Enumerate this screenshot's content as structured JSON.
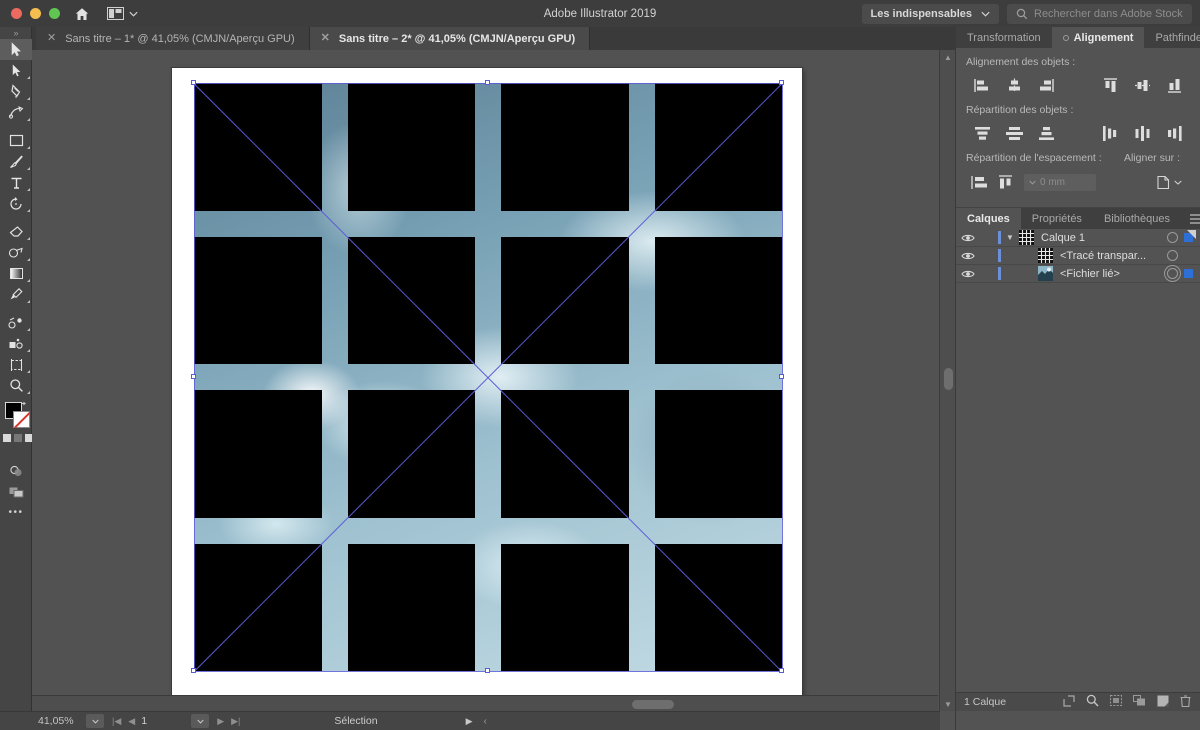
{
  "window": {
    "app_title": "Adobe Illustrator 2019",
    "traffic_lights": [
      "close-red",
      "minimize-yellow",
      "maximize-green"
    ],
    "home_icon": "home-icon",
    "arrange_documents_icon": "arrange-documents-icon",
    "workspace_label": "Les indispensables",
    "workspace_chevron": "chevron-down-icon",
    "stock_search_placeholder": "Rechercher dans Adobe Stock",
    "stock_search_icon": "search-icon"
  },
  "tabs": [
    {
      "label": "Sans titre – 1* @ 41,05% (CMJN/Aperçu GPU)",
      "active": false,
      "close_icon": "close-icon"
    },
    {
      "label": "Sans titre – 2* @ 41,05% (CMJN/Aperçu GPU)",
      "active": true,
      "close_icon": "close-icon"
    }
  ],
  "toolbar": {
    "grip": "»",
    "tools": [
      {
        "name": "selection-tool",
        "label": "Sélection",
        "selected": true,
        "flyout": false
      },
      {
        "name": "direct-selection-tool",
        "label": "Sélection directe",
        "selected": false,
        "flyout": true
      },
      {
        "name": "pen-tool",
        "label": "Plume",
        "selected": false,
        "flyout": true
      },
      {
        "name": "curvature-tool",
        "label": "Courbure",
        "selected": false,
        "flyout": true
      },
      {
        "name": "rectangle-tool",
        "label": "Rectangle",
        "selected": false,
        "flyout": true
      },
      {
        "name": "paintbrush-tool",
        "label": "Pinceau",
        "selected": false,
        "flyout": true
      },
      {
        "name": "type-tool",
        "label": "Texte",
        "selected": false,
        "flyout": true
      },
      {
        "name": "rotate-tool",
        "label": "Rotation",
        "selected": false,
        "flyout": true
      },
      {
        "name": "eraser-tool",
        "label": "Gomme",
        "selected": false,
        "flyout": true
      },
      {
        "name": "shape-builder-tool",
        "label": "Concepteur de forme",
        "selected": false,
        "flyout": true
      },
      {
        "name": "gradient-tool",
        "label": "Dégradé",
        "selected": false,
        "flyout": true
      },
      {
        "name": "eyedropper-tool",
        "label": "Pipette",
        "selected": false,
        "flyout": true
      },
      {
        "name": "blend-tool",
        "label": "Dégradé de formes",
        "selected": false,
        "flyout": true
      },
      {
        "name": "symbol-sprayer-tool",
        "label": "Pulvérisation de symboles",
        "selected": false,
        "flyout": true
      },
      {
        "name": "artboard-tool",
        "label": "Plan de travail",
        "selected": false,
        "flyout": true
      },
      {
        "name": "zoom-tool",
        "label": "Zoom",
        "selected": false,
        "flyout": true
      }
    ],
    "bottom": {
      "change_screen_mode": "screen-mode-icon",
      "swap_fill_stroke": "swap-arrow-icon",
      "fill_color": "#000000",
      "stroke_color": "#ffffff",
      "none_color": "#d8372b",
      "drawing_modes": "drawing-modes-icon",
      "edit_toolbar": "more-options-icon",
      "edit_toolbar_glyph": "•••"
    }
  },
  "canvas": {
    "artboard_background": "#ffffff",
    "canvas_background": "#525252",
    "selection_color": "#5b5bd6",
    "anchor_fill": "#ffffff",
    "grid": {
      "rows": 4,
      "cols": 4,
      "cell_color": "#000000"
    },
    "image_name": "sky-clouds-image",
    "diagonals": 2
  },
  "statusbar": {
    "zoom_level": "41,05%",
    "zoom_dropdown_icon": "chevron-down-icon",
    "first_page_icon": "first-page-icon",
    "prev_page_icon": "prev-page-icon",
    "page_number": "1",
    "page_dropdown_icon": "chevron-down-icon",
    "next_page_icon": "next-page-icon",
    "last_page_icon": "last-page-icon",
    "current_tool": "Sélection",
    "play_icon": "play-icon",
    "expand_icon": "chevron-left-icon"
  },
  "align_panel": {
    "tabs": [
      {
        "label": "Transformation",
        "active": false
      },
      {
        "label": "Alignement",
        "active": true,
        "dot": "panel-dot-icon"
      },
      {
        "label": "Pathfinder",
        "active": false
      }
    ],
    "menu_icon": "panel-menu-icon",
    "objects_align_label": "Alignement des objets :",
    "objects_align_buttons": [
      "align-left-icon",
      "align-horizontal-center-icon",
      "align-right-icon",
      "align-top-icon",
      "align-vertical-center-icon",
      "align-bottom-icon"
    ],
    "objects_distribute_label": "Répartition des objets :",
    "objects_distribute_buttons": [
      "distribute-top-icon",
      "distribute-vertical-center-icon",
      "distribute-bottom-icon",
      "distribute-left-icon",
      "distribute-horizontal-center-icon",
      "distribute-right-icon"
    ],
    "spacing_label": "Répartition de l'espacement :",
    "spacing_buttons": [
      "distribute-vertical-space-icon",
      "distribute-horizontal-space-icon"
    ],
    "spacing_value": "0 mm",
    "spacing_dropdown_icon": "chevron-down-icon",
    "align_to_label": "Aligner sur :",
    "align_to_icon": "align-to-artboard-icon",
    "align_to_chevron": "chevron-down-icon"
  },
  "layers_panel": {
    "tabs": [
      {
        "label": "Calques",
        "active": true
      },
      {
        "label": "Propriétés",
        "active": false
      },
      {
        "label": "Bibliothèques",
        "active": false
      }
    ],
    "menu_icon": "panel-menu-icon",
    "rows": [
      {
        "name": "Calque 1",
        "visible": true,
        "eye_icon": "eye-icon",
        "expanded": true,
        "chevron_icon": "chevron-down-icon",
        "thumb": "grid-thumbnail",
        "indent": 0,
        "target_selected": false,
        "has_selection_square": true,
        "selection_color": "#2d6fd4"
      },
      {
        "name": "<Tracé transpar...",
        "visible": true,
        "eye_icon": "eye-icon",
        "expanded": false,
        "thumb": "grid-thumbnail",
        "indent": 1,
        "target_selected": false,
        "has_selection_square": false,
        "selection_color": "#2d6fd4"
      },
      {
        "name": "<Fichier lié>",
        "visible": true,
        "eye_icon": "eye-icon",
        "expanded": false,
        "thumb": "sky-thumbnail",
        "indent": 1,
        "target_selected": true,
        "has_selection_square": true,
        "selection_color": "#2d6fd4"
      }
    ],
    "footer": {
      "count_label": "1 Calque",
      "buttons": [
        "isolate-icon",
        "locate-object-icon",
        "make-clipping-mask-icon",
        "create-sublayer-icon",
        "new-layer-icon",
        "delete-layer-icon"
      ]
    }
  }
}
